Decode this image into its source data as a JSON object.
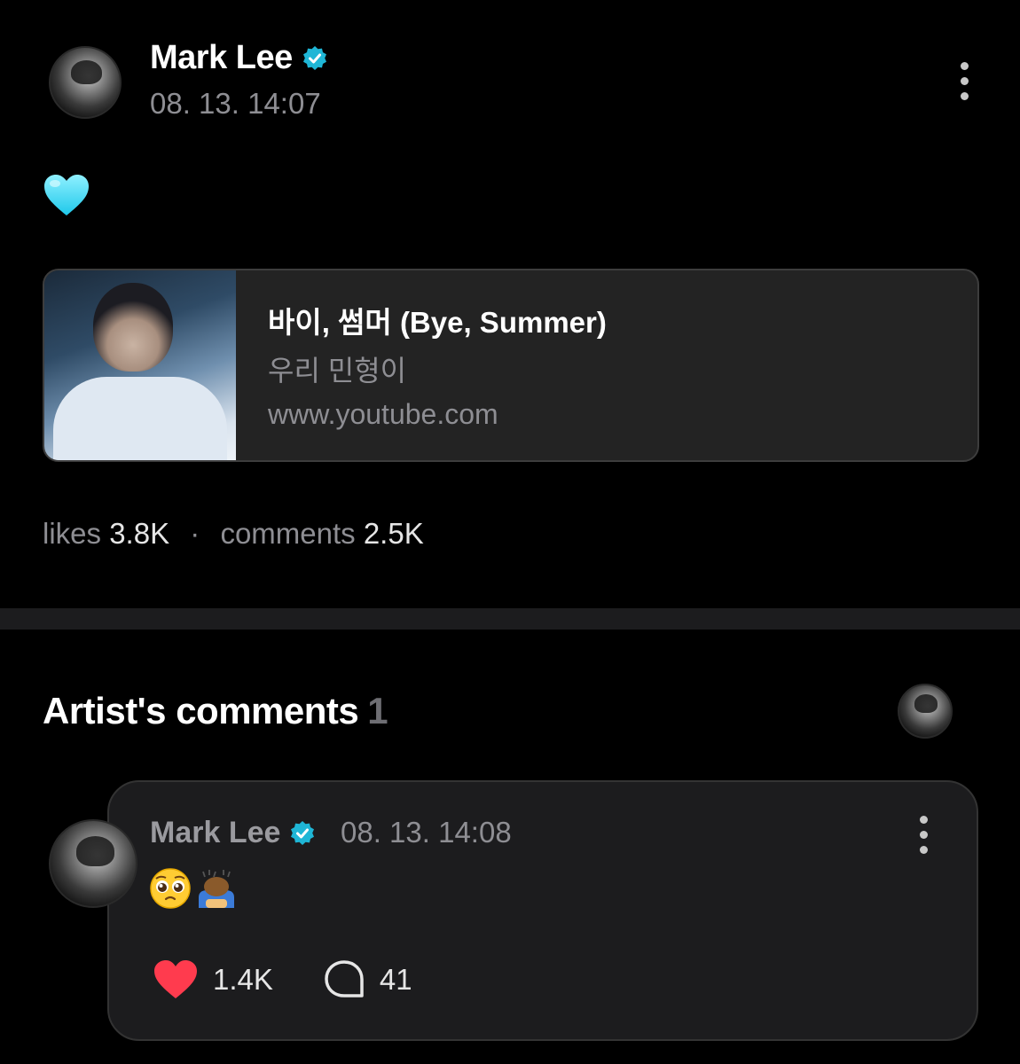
{
  "post": {
    "author": "Mark Lee",
    "timestamp": "08. 13. 14:07",
    "text_emoji_icon": "blue-heart-icon",
    "link": {
      "title": "바이, 썸머 (Bye, Summer)",
      "subtitle": "우리 민형이",
      "url": "www.youtube.com"
    },
    "stats": {
      "likes_label": "likes",
      "likes_value": "3.8K",
      "separator": "·",
      "comments_label": "comments",
      "comments_value": "2.5K"
    }
  },
  "artist_comments": {
    "title": "Artist's comments",
    "count": "1",
    "comment": {
      "author": "Mark Lee",
      "timestamp": "08. 13. 14:08",
      "emojis": [
        "pleading-face-icon",
        "person-bowing-icon"
      ],
      "likes": "1.4K",
      "replies": "41"
    }
  },
  "colors": {
    "background": "#000000",
    "card": "#1c1c1e",
    "verified": "#1fb6d6",
    "heart": "#ff3b4e",
    "muted": "#8e8e93"
  }
}
